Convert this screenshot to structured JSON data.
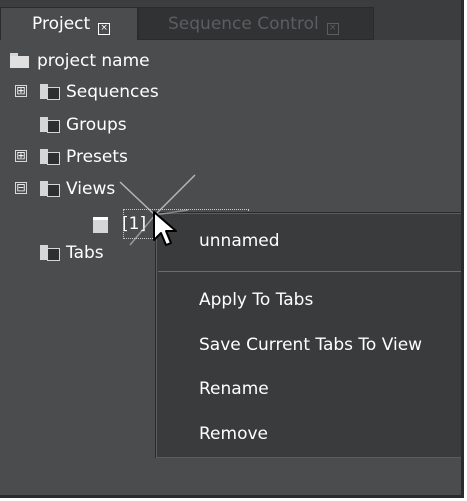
{
  "tabs": [
    {
      "label": "Project",
      "active": true
    },
    {
      "label": "Sequence Control",
      "active": false
    }
  ],
  "tree": {
    "root": "project name",
    "items": [
      {
        "label": "Sequences",
        "expander": "⊞",
        "icon": "sequences-folder-icon"
      },
      {
        "label": "Groups",
        "expander": "",
        "icon": "groups-folder-icon"
      },
      {
        "label": "Presets",
        "expander": "⊞",
        "icon": "presets-folder-icon"
      },
      {
        "label": "Views",
        "expander": "⊟",
        "icon": "views-folder-icon"
      },
      {
        "label": "Tabs",
        "expander": "",
        "icon": "tabs-folder-icon"
      }
    ],
    "view_child": "[1]"
  },
  "context_menu": {
    "header": "unnamed",
    "items": [
      "Apply To Tabs",
      "Save Current Tabs To View",
      "Rename",
      "Remove"
    ]
  },
  "colors": {
    "panel_bg": "#4a4c4e",
    "menu_bg": "#3a3b3d",
    "text": "#ffffff",
    "inactive_tab_text": "#5b5d60"
  }
}
